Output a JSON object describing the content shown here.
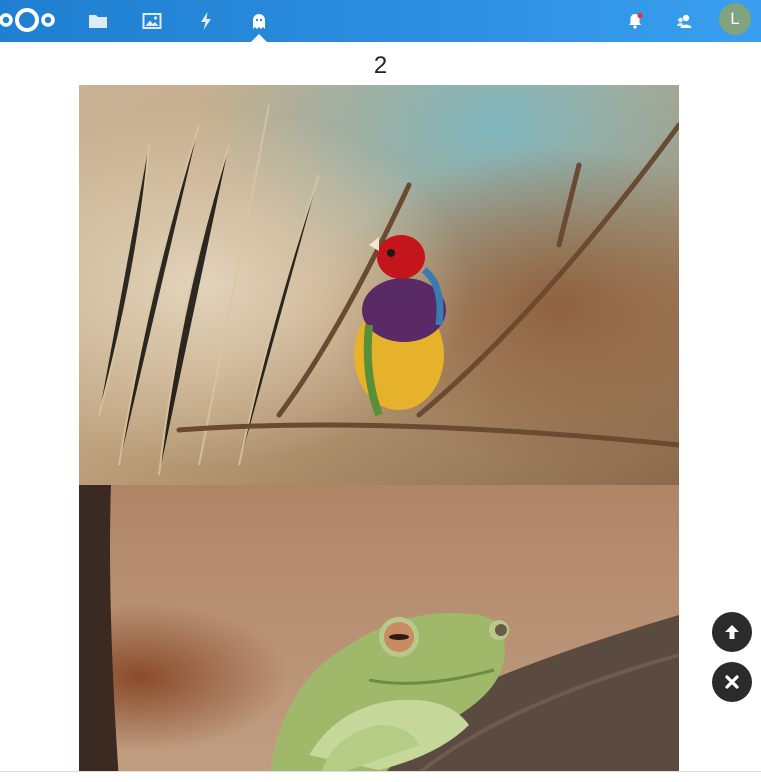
{
  "header": {
    "apps": [
      {
        "name": "files",
        "icon": "folder-icon"
      },
      {
        "name": "photos",
        "icon": "image-icon"
      },
      {
        "name": "activity",
        "icon": "lightning-icon"
      },
      {
        "name": "ghost app",
        "icon": "ghost-icon",
        "active": true
      }
    ],
    "right": {
      "notifications_icon": "bell-icon",
      "contacts_icon": "contacts-icon",
      "avatar_initial": "L",
      "avatar_color": "#7fa47f",
      "notification_dot": true
    },
    "brand_color": "#2c8ee0"
  },
  "viewer": {
    "page_number": "2",
    "images": [
      {
        "subject": "bird-photo"
      },
      {
        "subject": "frog-photo"
      }
    ]
  },
  "floating_actions": [
    {
      "icon": "arrow-up-icon"
    },
    {
      "icon": "close-icon"
    }
  ]
}
